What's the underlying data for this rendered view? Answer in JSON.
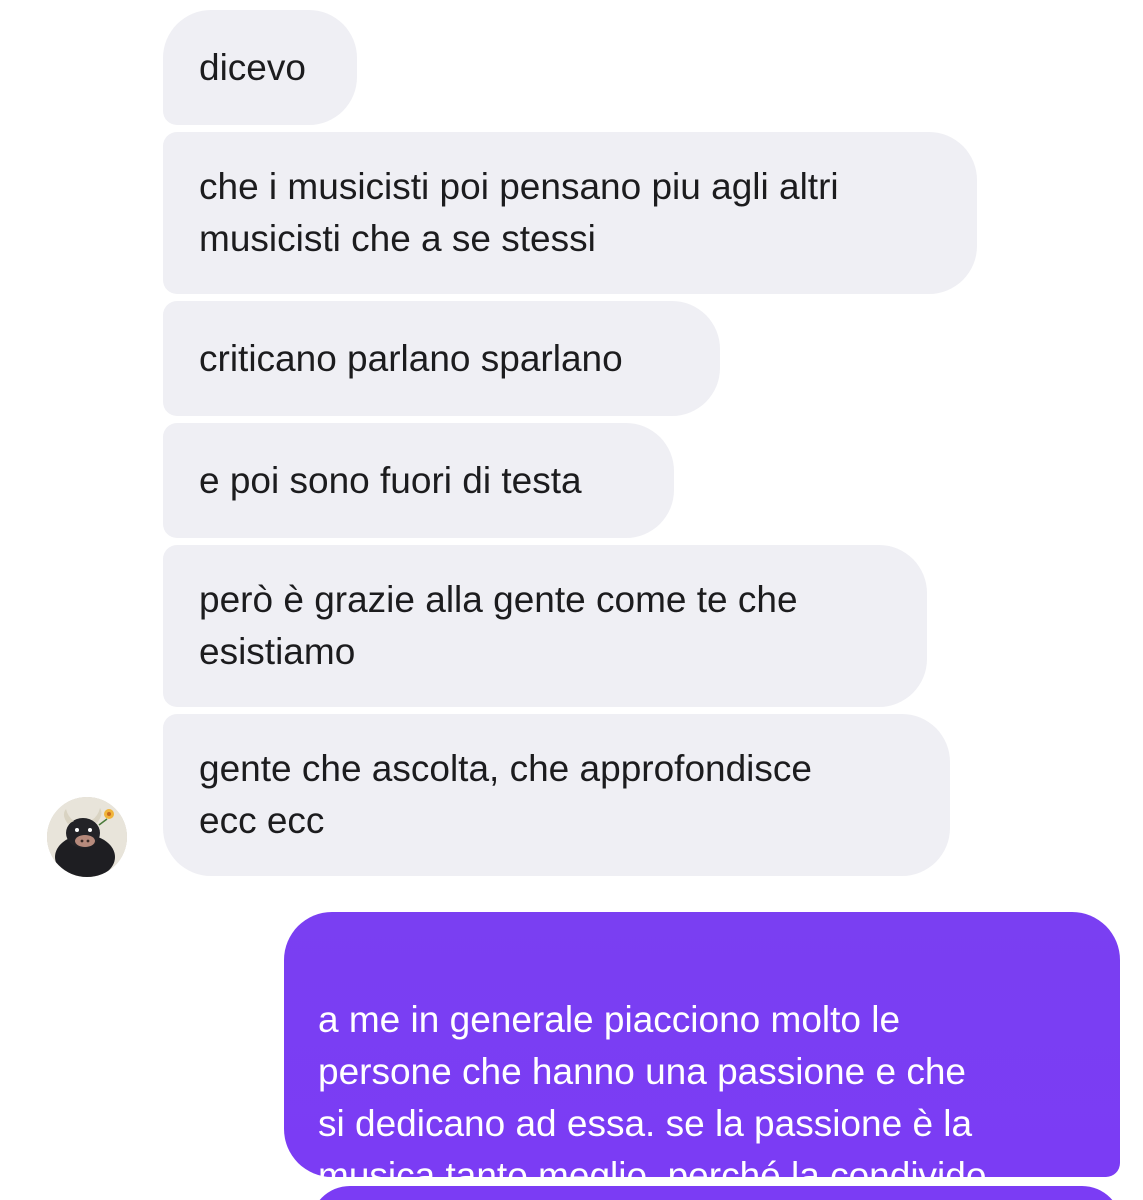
{
  "conversation": {
    "incoming": [
      {
        "text": "dicevo"
      },
      {
        "text": "che i musicisti poi pensano piu agli altri\nmusicisti che a se stessi"
      },
      {
        "text": "criticano parlano sparlano"
      },
      {
        "text": "e poi sono fuori di testa"
      },
      {
        "text": "però è grazie alla gente come te che\nesistiamo"
      },
      {
        "text": "gente che ascolta, che approfondisce\necc ecc"
      }
    ],
    "outgoing": [
      {
        "text": "a me in generale piacciono molto le\npersone che hanno una passione e che\nsi dedicano ad essa. se la passione è la\nmusica tanto meglio, perché la condivido"
      }
    ],
    "sender_avatar": {
      "icon": "bull-avatar-icon"
    }
  },
  "colors": {
    "incoming_bubble": "#efeff4",
    "outgoing_bubble": "#7b3cf4",
    "incoming_text": "#1c1c1e",
    "outgoing_text": "#ffffff"
  }
}
